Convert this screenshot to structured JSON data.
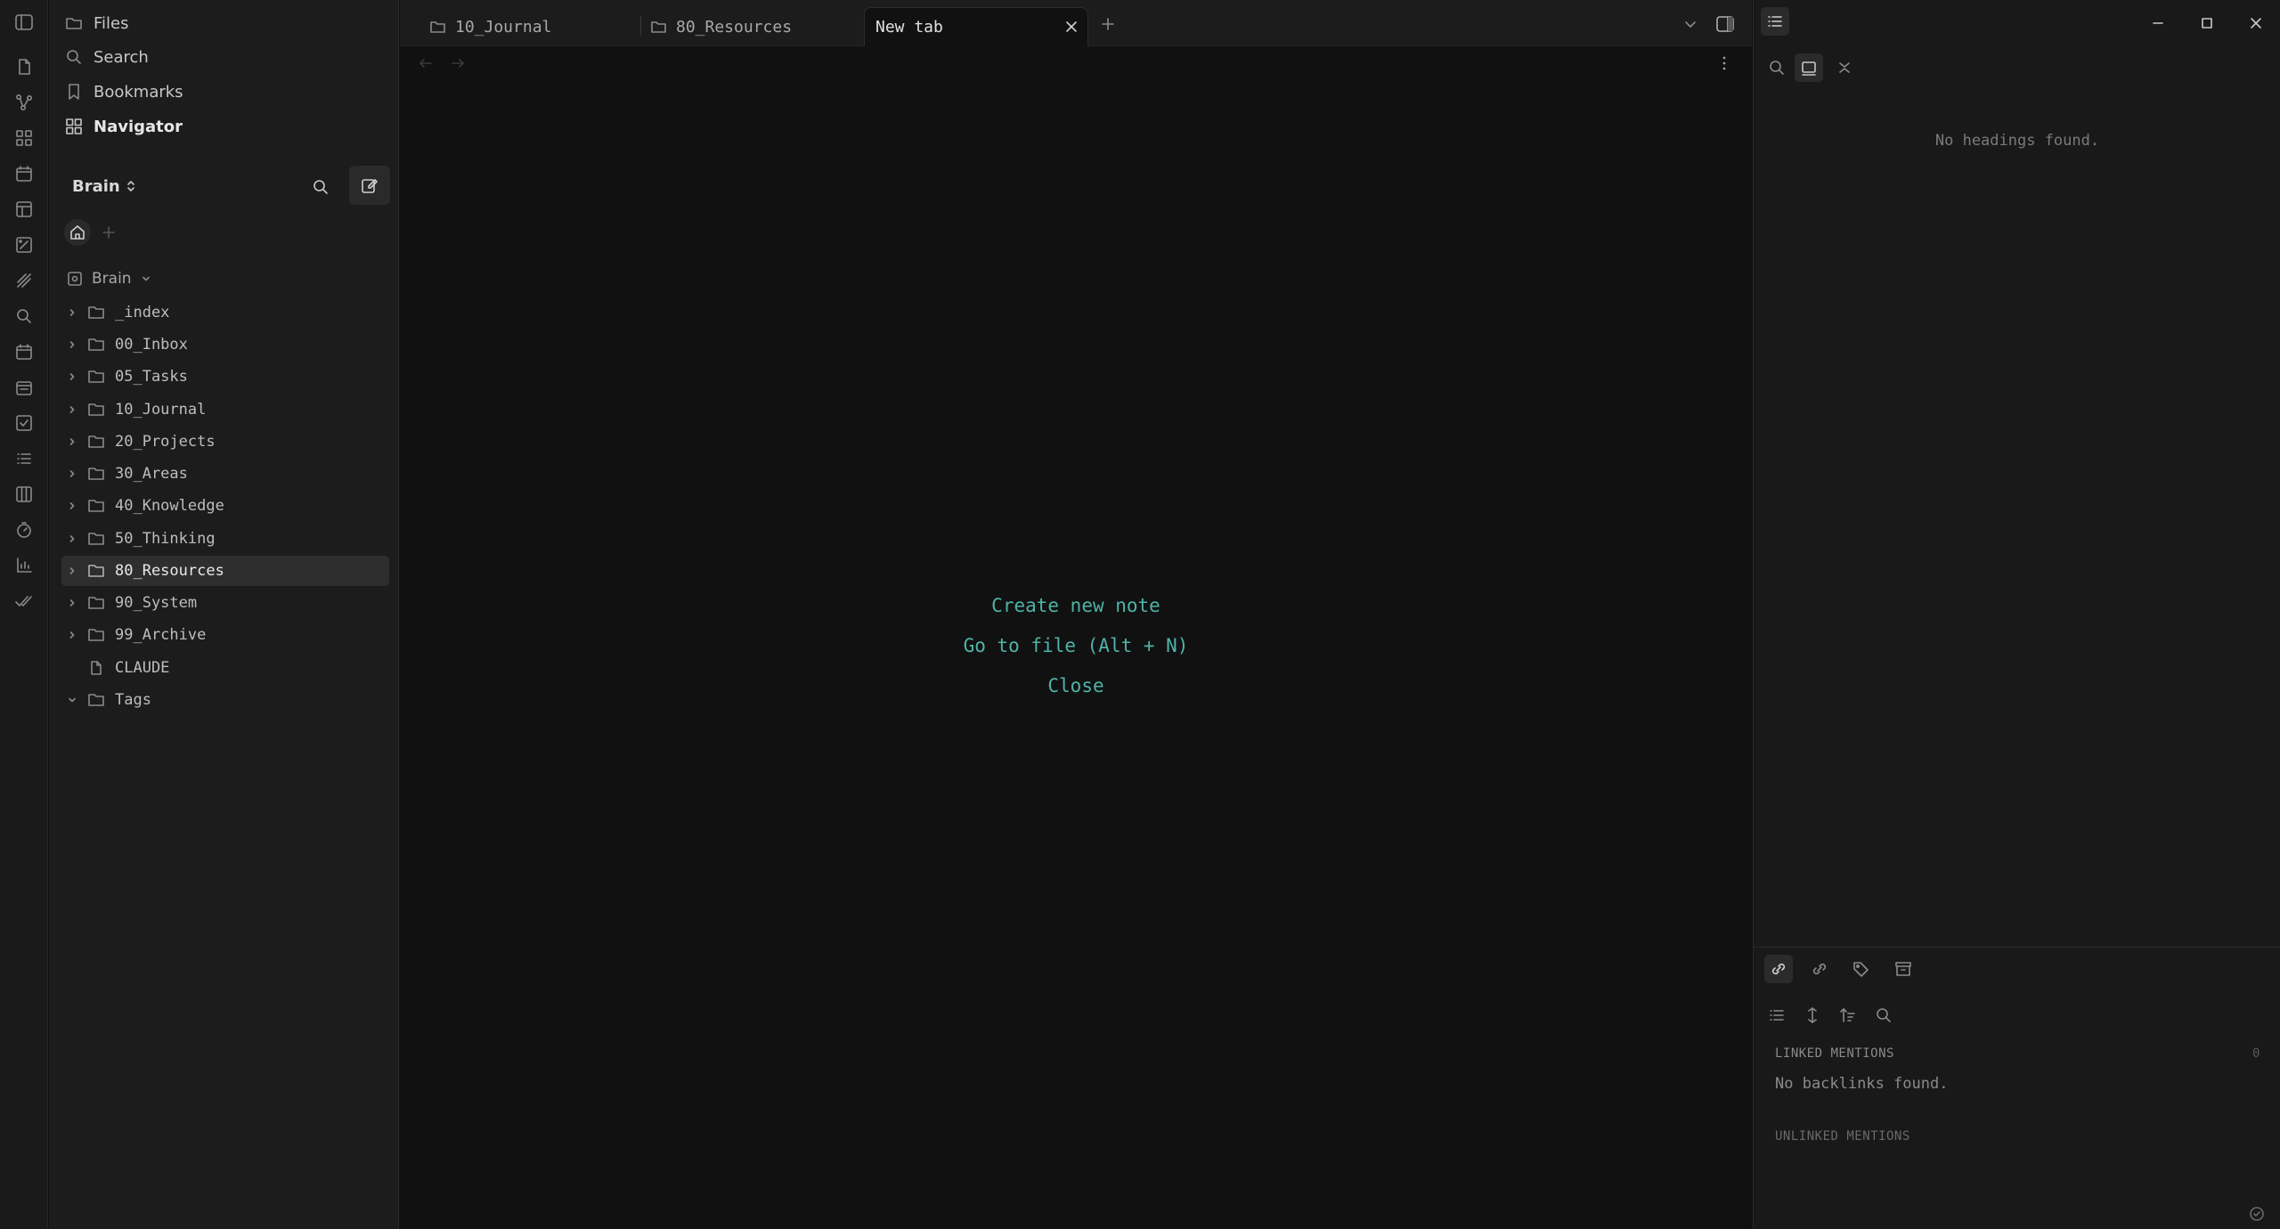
{
  "sidebar": {
    "nav": [
      {
        "label": "Files",
        "icon": "folder-icon"
      },
      {
        "label": "Search",
        "icon": "search-icon"
      },
      {
        "label": "Bookmarks",
        "icon": "bookmark-icon"
      },
      {
        "label": "Navigator",
        "icon": "grid-icon"
      }
    ],
    "vault_name": "Brain",
    "vault_root": "Brain",
    "tree": [
      {
        "label": "_index",
        "type": "folder",
        "expanded": false
      },
      {
        "label": "00_Inbox",
        "type": "folder",
        "expanded": false
      },
      {
        "label": "05_Tasks",
        "type": "folder",
        "expanded": false
      },
      {
        "label": "10_Journal",
        "type": "folder",
        "expanded": false
      },
      {
        "label": "20_Projects",
        "type": "folder",
        "expanded": false
      },
      {
        "label": "30_Areas",
        "type": "folder",
        "expanded": false
      },
      {
        "label": "40_Knowledge",
        "type": "folder",
        "expanded": false
      },
      {
        "label": "50_Thinking",
        "type": "folder",
        "expanded": false
      },
      {
        "label": "80_Resources",
        "type": "folder",
        "expanded": false,
        "selected": true
      },
      {
        "label": "90_System",
        "type": "folder",
        "expanded": false
      },
      {
        "label": "99_Archive",
        "type": "folder",
        "expanded": false
      },
      {
        "label": "CLAUDE",
        "type": "file"
      },
      {
        "label": "Tags",
        "type": "folder",
        "expanded": true
      }
    ]
  },
  "tabs": [
    {
      "label": "10_Journal",
      "active": false
    },
    {
      "label": "80_Resources",
      "active": false
    },
    {
      "label": "New tab",
      "active": true
    }
  ],
  "main": {
    "actions": [
      "Create new note",
      "Go to file (Alt + N)",
      "Close"
    ]
  },
  "outline": {
    "empty_text": "No headings found."
  },
  "backlinks": {
    "linked_label": "LINKED MENTIONS",
    "linked_count": "0",
    "empty_text": "No backlinks found.",
    "unlinked_label": "UNLINKED MENTIONS"
  },
  "colors": {
    "accent": "#4fb3a8",
    "background": "#111111",
    "sidebar": "#1c1c1c",
    "selection": "#2e2e2e"
  }
}
